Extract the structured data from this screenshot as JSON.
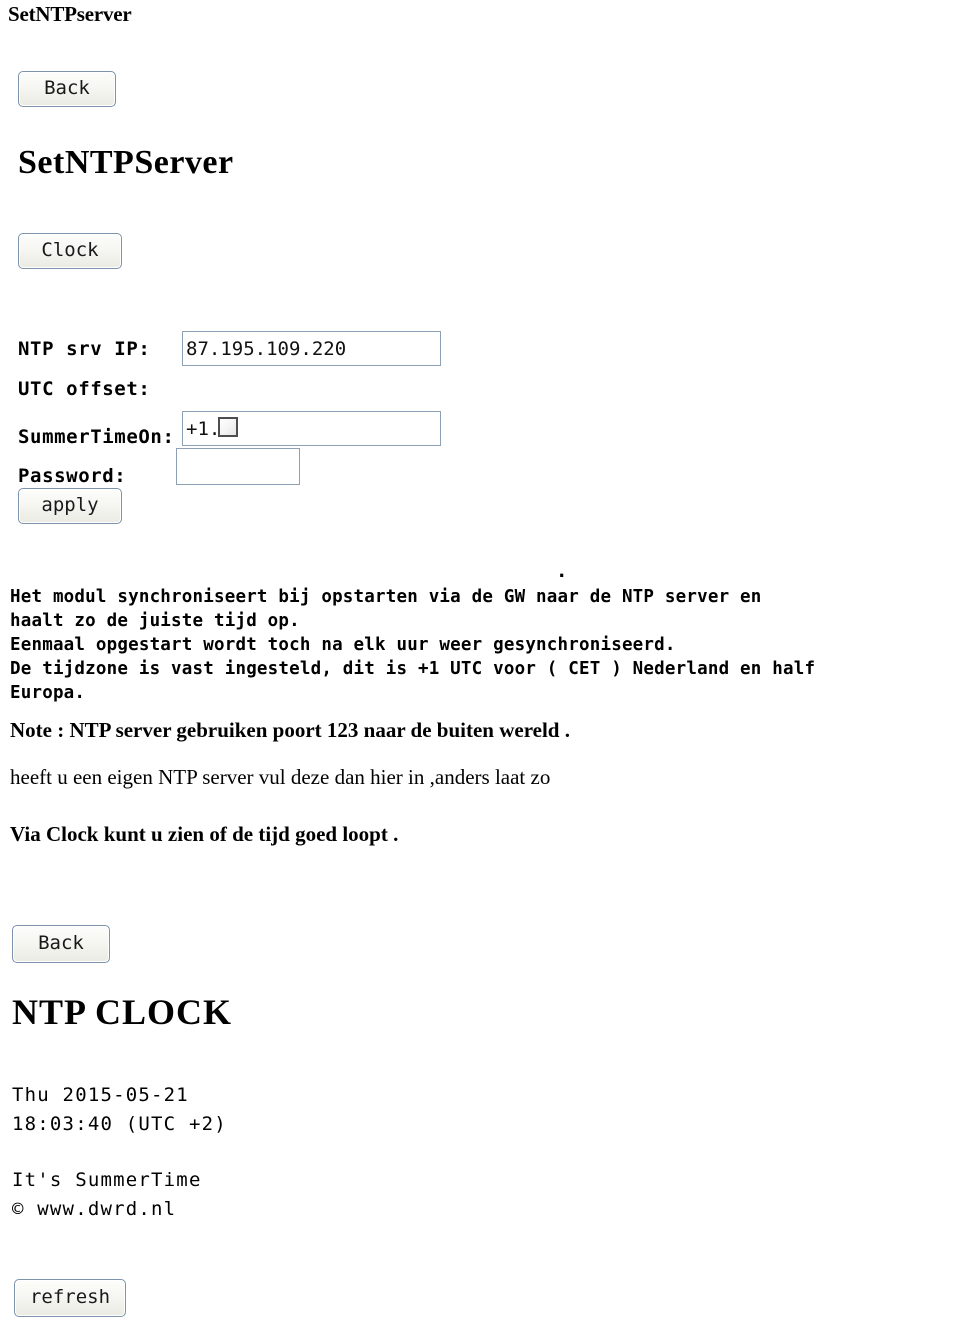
{
  "document": {
    "title": "SetNTPserver"
  },
  "section_ntp": {
    "back_label": "Back",
    "heading": "SetNTPServer",
    "clock_label": "Clock",
    "apply_label": "apply",
    "fields": {
      "ntp_ip": {
        "label": "NTP srv IP:",
        "value": "87.195.109.220",
        "placeholder": ""
      },
      "utc_offset": {
        "label": "UTC offset:",
        "value": "+1.0",
        "placeholder": ""
      },
      "summer_time": {
        "label": "SummerTimeOn:",
        "checked": false
      },
      "password": {
        "label": "Password:",
        "value": "",
        "placeholder": ""
      }
    }
  },
  "description": {
    "stray_dot": ".",
    "mono_text": "Het modul synchroniseert bij opstarten via de GW naar de NTP server en\nhaalt zo de juiste tijd op.\nEenmaal opgestart wordt toch na elk uur weer gesynchroniseerd.\nDe tijdzone is vast ingesteld, dit is +1 UTC voor ( CET ) Nederland en half\nEuropa.",
    "note_1": "Note : NTP server gebruiken poort 123  naar de buiten wereld .",
    "note_2": "heeft u een eigen NTP server vul deze dan hier in ,anders laat zo",
    "note_3": "Via Clock  kunt u zien of de tijd goed loopt ."
  },
  "section_clock": {
    "back_label": "Back",
    "heading": "NTP CLOCK",
    "readout": "Thu 2015-05-21\n18:03:40 (UTC +2)",
    "footer": "It's SummerTime\n© www.dwrd.nl",
    "refresh_label": "refresh"
  },
  "colors": {
    "page_background": "#ffffff",
    "text": "#000000",
    "button_border": "#7d93ab",
    "input_border": "#8ea0b4",
    "checkbox_border": "#4d4d4d"
  }
}
